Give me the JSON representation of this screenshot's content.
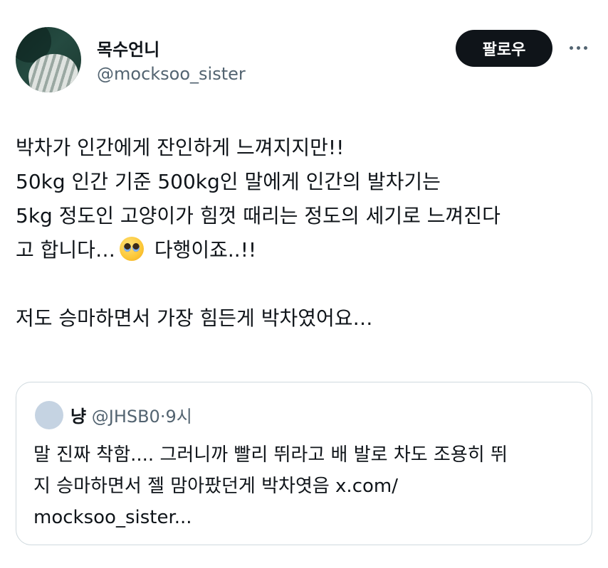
{
  "author": {
    "name": "목수언니",
    "handle": "@mocksoo_sister",
    "follow_label": "팔로우"
  },
  "tweet": {
    "lines": [
      "박차가 인간에게 잔인하게 느껴지지만!!",
      "50kg 인간 기준 500kg인 말에게 인간의 발차기는",
      "5kg 정도인 고양이가 힘껏 때리는 정도의 세기로 느껴진다",
      "고 합니다…",
      "다행이죠..!!",
      "",
      "저도 승마하면서 가장 힘든게 박차였어요…"
    ],
    "emoji": "pleading-face"
  },
  "quote": {
    "name": "냥",
    "handle": "@JHSB0",
    "separator": "·",
    "time": "9시",
    "lines": [
      "말 진짜 착함.... 그러니까 빨리 뛰라고 배 발로 차도 조용히 뛰",
      "지 승마하면서 젤 맘아팠던게 박차엿음 x.com/",
      "mocksoo_sister..."
    ]
  },
  "colors": {
    "text": "#0f1419",
    "muted": "#536471",
    "border": "#cfd9de",
    "button": "#0f1419"
  }
}
